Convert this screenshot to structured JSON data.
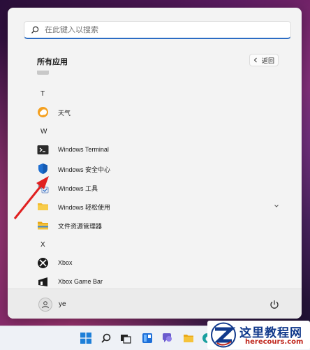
{
  "search": {
    "placeholder": "在此键入以搜索",
    "icon": "search-icon"
  },
  "all_apps": {
    "title": "所有应用",
    "back_label": "返回"
  },
  "list": [
    {
      "kind": "letter",
      "text": "T"
    },
    {
      "kind": "app",
      "label": "天气",
      "icon": "weather-icon"
    },
    {
      "kind": "letter",
      "text": "W"
    },
    {
      "kind": "app",
      "label": "Windows Terminal",
      "icon": "terminal-icon"
    },
    {
      "kind": "app",
      "label": "Windows 安全中心",
      "icon": "shield-icon"
    },
    {
      "kind": "app",
      "label": "Windows 工具",
      "icon": "tools-icon"
    },
    {
      "kind": "folder",
      "label": "Windows 轻松使用",
      "icon": "folder-icon",
      "expandable": true
    },
    {
      "kind": "app",
      "label": "文件资源管理器",
      "icon": "file-explorer-icon"
    },
    {
      "kind": "letter",
      "text": "X"
    },
    {
      "kind": "app",
      "label": "Xbox",
      "icon": "xbox-icon"
    },
    {
      "kind": "app",
      "label": "Xbox Game Bar",
      "icon": "xbox-game-bar-icon"
    }
  ],
  "user": {
    "name": "ye"
  },
  "taskbar": [
    "windows-start-icon",
    "search-icon",
    "task-view-icon",
    "widgets-icon",
    "chat-icon",
    "file-explorer-icon",
    "edge-icon"
  ],
  "watermark": {
    "title": "这里教程网",
    "url": "herecours.com"
  },
  "colors": {
    "accent": "#2b6cc4",
    "arrow": "#e02020",
    "weather": "#f4a020",
    "shield": "#1f6fd1"
  }
}
